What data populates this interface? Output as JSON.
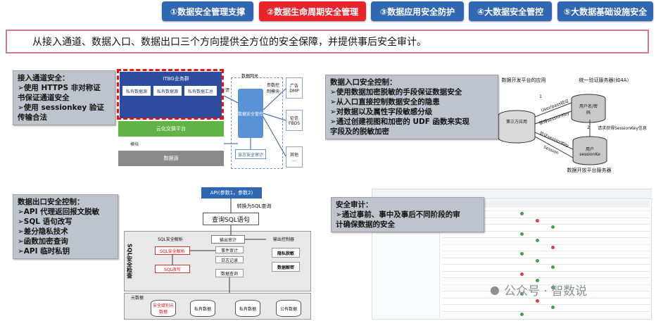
{
  "tabs": [
    {
      "label": "①数据安全管理支撑",
      "active": false
    },
    {
      "label": "②数据生命周期安全管理",
      "active": true
    },
    {
      "label": "③数据应用安全防护",
      "active": false
    },
    {
      "label": "④大数据安全管控",
      "active": false
    },
    {
      "label": "⑤大数据基础设施安全",
      "active": false
    }
  ],
  "banner": "从接入通道、数据入口、数据出口三个方向提供全方位的安全保障，并提供事后安全审计。",
  "q1": {
    "note": [
      "接入通道安全：",
      "➢使用 HTTPS 非对称证",
      "书保证通道安全",
      "➢使用 sessionkey 验证",
      "传输合法"
    ],
    "app_layer": "ITBG业务群",
    "sub_apps": [
      "私有数据源",
      "私有数据源",
      "私有数据汇总"
    ],
    "cloud": "云化交换平台",
    "db": "数据源",
    "gateway": "数据网关",
    "engine": "数据安全管控",
    "gateway_side": "参数控\n制模块",
    "audit": "日志安全审计",
    "feedback": "反馈",
    "left_label": "模块",
    "targets": [
      "广告\nDMP",
      "征信\nFBDS",
      "其他\n…"
    ]
  },
  "q2": {
    "note": [
      "数据入口安全控制：",
      "➢使用数据加密脱敏的手段保证数据安全",
      "➢从入口直接控制数据安全的隐患",
      "➢对数据以及属性字段敏感分级",
      "➢通过创建视图和加密的 UDF 函数来实现",
      "字段及的脱敏加密"
    ],
    "app_label": "数据开发平台的应用",
    "third_app": "第三方应用",
    "auth_server": "统一验证服务器(如4A）",
    "user_pass": "用户名/密\n码",
    "user_key": "用户\nsessionKe",
    "platform_server": "数据开放平台服务器",
    "arrow1": "User/pass验证",
    "arrow2": "获得sessionKey",
    "arrow3": "请求获得SessionKey信息",
    "arrow4": "验证sessionKey",
    "arrow5": "Session",
    "step1": "1",
    "step2": "2"
  },
  "q3": {
    "note": [
      "数据出口安全控制：",
      "➢API 代理返回报文脱敏",
      "➢SQL 语句改写",
      "➢差分隐私技术",
      "➢函数加密查询",
      "➢API 临时私钥"
    ],
    "api": "API(参数1，参数2)",
    "convert": "转换为SQL查询",
    "query": "查询SQL语句",
    "side_label": "SQL安全检查",
    "parse": "SQL安全解析",
    "output": "输出审计",
    "control": "输出控制器",
    "sec_parse": "SQL安全解析",
    "rewrite": "SQL改写",
    "event": "事件审计",
    "log": "日志记录",
    "data_query": "数据查询",
    "privacy": "隐私脱敏",
    "decrypt": "数据解密",
    "meta": "元数据",
    "stores": [
      "安全级别元数据",
      "私有数据",
      "私有数据",
      "公有数据"
    ]
  },
  "q4": {
    "note": [
      "安全审计：",
      "➢通过事前、事中及事后不同阶段的审",
      "计确保数据的安全"
    ],
    "watermark": "公众号 · 智数说",
    "status_labels": [
      "严重危害",
      "未处理",
      "已处理"
    ]
  }
}
